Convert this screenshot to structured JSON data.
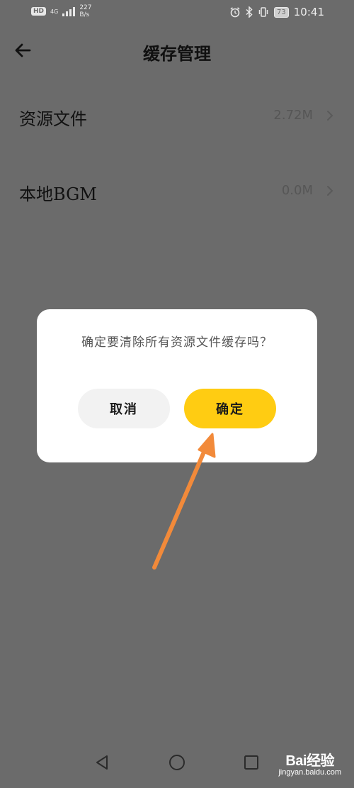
{
  "status_bar": {
    "hd": "HD",
    "network": "4G",
    "speed_value": "227",
    "speed_unit": "B/s",
    "battery": "73",
    "time": "10:41"
  },
  "header": {
    "title": "缓存管理"
  },
  "rows": [
    {
      "label": "资源文件",
      "value": "2.72M"
    },
    {
      "label": "本地BGM",
      "value": "0.0M"
    }
  ],
  "dialog": {
    "message": "确定要清除所有资源文件缓存吗？",
    "cancel_label": "取消",
    "confirm_label": "确定"
  },
  "colors": {
    "overlay_bg": "#6b6b6b",
    "confirm_button": "#ffcc12",
    "cancel_button": "#f2f2f2",
    "annotation_arrow": "#f28a3a"
  },
  "icons": {
    "back": "arrow-left-icon",
    "chevron": "chevron-right-icon",
    "nav_back": "triangle-back-icon",
    "nav_home": "circle-home-icon",
    "nav_recent": "square-recent-icon"
  },
  "watermark": {
    "main": "Bai经验",
    "sub": "jingyan.baidu.com"
  }
}
